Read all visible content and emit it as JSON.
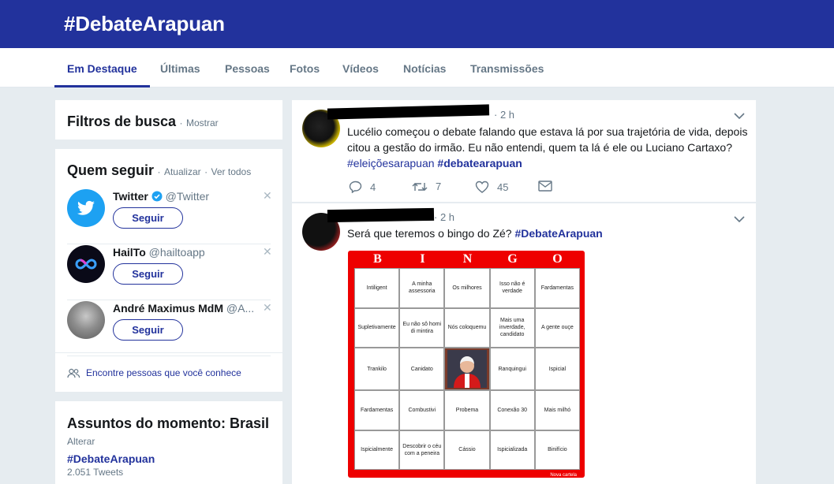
{
  "header": {
    "title": "#DebateArapuan"
  },
  "tabs": [
    {
      "label": "Em Destaque"
    },
    {
      "label": "Últimas"
    },
    {
      "label": "Pessoas"
    },
    {
      "label": "Fotos"
    },
    {
      "label": "Vídeos"
    },
    {
      "label": "Notícias"
    },
    {
      "label": "Transmissões"
    }
  ],
  "filters": {
    "title": "Filtros de busca",
    "show_link": "Mostrar"
  },
  "who_to_follow": {
    "title": "Quem seguir",
    "refresh_link": "Atualizar",
    "view_all_link": "Ver todos",
    "follow_label": "Seguir",
    "accounts": [
      {
        "name": "Twitter",
        "handle": "@Twitter",
        "verified": true
      },
      {
        "name": "HailTo",
        "handle": "@hailtoapp"
      },
      {
        "name": "André Maximus MdM",
        "handle": "@A..."
      }
    ],
    "find_people": "Encontre pessoas que você conhece"
  },
  "trends": {
    "title": "Assuntos do momento: Brasil",
    "change_link": "Alterar",
    "items": [
      {
        "tag": "#DebateArapuan",
        "count": "2.051 Tweets"
      }
    ]
  },
  "tweets": [
    {
      "time": "2 h",
      "text": "Lucélio começou o debate falando que estava lá por sua trajetória de vida, depois citou a gestão do irmão. Eu não entendi, quem ta lá é ele ou Luciano Cartaxo?",
      "hashtag1": "#eleiçõesarapuan",
      "hashtag2": "#debatearapuan",
      "replies": "4",
      "retweets": "7",
      "likes": "45"
    },
    {
      "time": "2 h",
      "text": "Será que teremos o bingo do Zé?",
      "hashtag": "#DebateArapuan",
      "bingo": {
        "letters": [
          "B",
          "I",
          "N",
          "G",
          "O"
        ],
        "cells": [
          "Intiligent",
          "A minha assessoria",
          "Os milhores",
          "Isso não é verdade",
          "Fardamentas",
          "Supletivamente",
          "Eu não sô homi di mintira",
          "Nós coloquemu",
          "Mais uma inverdade, candidato",
          "A gente ouçe",
          "Trankilo",
          "Canidato",
          "",
          "Ranquingui",
          "Ispicial",
          "Fardamentas",
          "Combustivi",
          "Probema",
          "Conexão 30",
          "Mais milhó",
          "Ispicialmente",
          "Descobrir o céu com a peneira",
          "Cássio",
          "Ispicializada",
          "Binifício"
        ],
        "footer": "Nova cartela"
      }
    }
  ],
  "colors": {
    "brand": "#22329c",
    "background": "#e6ecf0",
    "muted": "#657786",
    "twitter_blue": "#1da1f2",
    "bingo_red": "#ee0000"
  }
}
